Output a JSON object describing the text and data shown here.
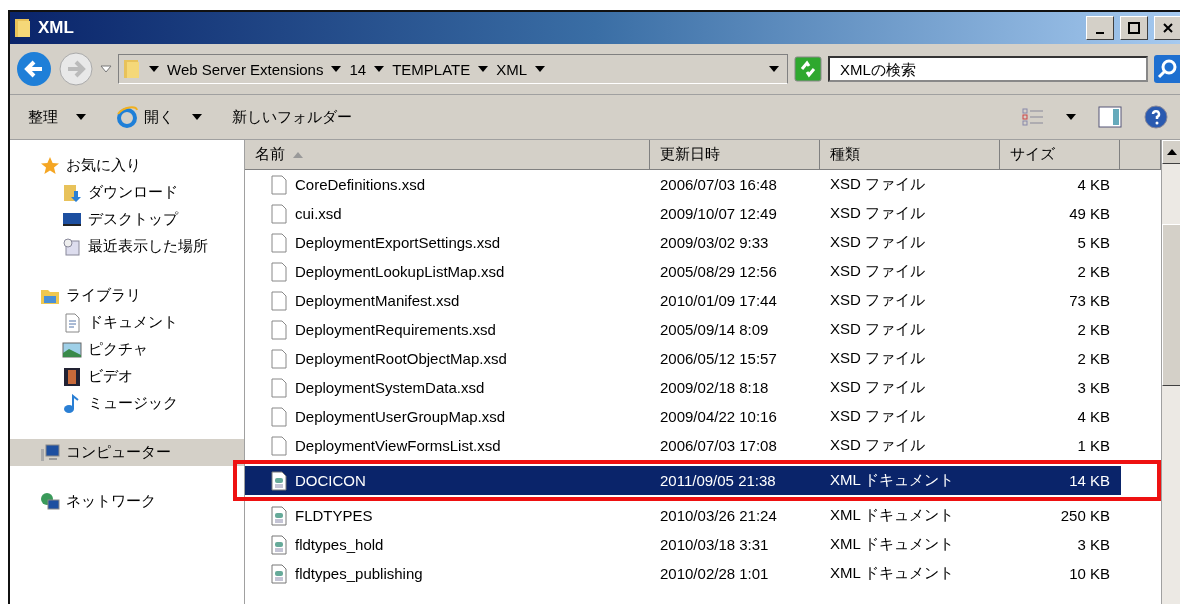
{
  "window": {
    "title": "XML"
  },
  "address": {
    "segments": [
      "Web Server Extensions",
      "14",
      "TEMPLATE",
      "XML"
    ]
  },
  "search": {
    "placeholder": "XMLの検索"
  },
  "toolbar": {
    "items": [
      {
        "label": "整理",
        "dropdown": true
      },
      {
        "label": "開く",
        "dropdown": true
      },
      {
        "label": "新しいフォルダー",
        "dropdown": false
      }
    ]
  },
  "sidebar": {
    "groups": [
      {
        "label": "お気に入り",
        "selected": false,
        "children": [
          {
            "label": "ダウンロード",
            "selected": false
          },
          {
            "label": "デスクトップ",
            "selected": false
          },
          {
            "label": "最近表示した場所",
            "selected": false
          }
        ]
      },
      {
        "label": "ライブラリ",
        "selected": false,
        "children": [
          {
            "label": "ドキュメント",
            "selected": false
          },
          {
            "label": "ピクチャ",
            "selected": false
          },
          {
            "label": "ビデオ",
            "selected": false
          },
          {
            "label": "ミュージック",
            "selected": false
          }
        ]
      },
      {
        "label": "コンピューター",
        "selected": true
      },
      {
        "label": "ネットワーク",
        "selected": false
      }
    ]
  },
  "table": {
    "columns": [
      {
        "label": "名前",
        "sorted": true
      },
      {
        "label": "更新日時",
        "sorted": false
      },
      {
        "label": "種類",
        "sorted": false
      },
      {
        "label": "サイズ",
        "sorted": false
      }
    ],
    "rows": [
      {
        "kind": "xsd",
        "name": "CoreDefinitions.xsd",
        "date": "2006/07/03 16:48",
        "type": "XSD ファイル",
        "size": "4 KB",
        "selected": false,
        "outlined": false
      },
      {
        "kind": "xsd",
        "name": "cui.xsd",
        "date": "2009/10/07 12:49",
        "type": "XSD ファイル",
        "size": "49 KB",
        "selected": false,
        "outlined": false
      },
      {
        "kind": "xsd",
        "name": "DeploymentExportSettings.xsd",
        "date": "2009/03/02 9:33",
        "type": "XSD ファイル",
        "size": "5 KB",
        "selected": false,
        "outlined": false
      },
      {
        "kind": "xsd",
        "name": "DeploymentLookupListMap.xsd",
        "date": "2005/08/29 12:56",
        "type": "XSD ファイル",
        "size": "2 KB",
        "selected": false,
        "outlined": false
      },
      {
        "kind": "xsd",
        "name": "DeploymentManifest.xsd",
        "date": "2010/01/09 17:44",
        "type": "XSD ファイル",
        "size": "73 KB",
        "selected": false,
        "outlined": false
      },
      {
        "kind": "xsd",
        "name": "DeploymentRequirements.xsd",
        "date": "2005/09/14 8:09",
        "type": "XSD ファイル",
        "size": "2 KB",
        "selected": false,
        "outlined": false
      },
      {
        "kind": "xsd",
        "name": "DeploymentRootObjectMap.xsd",
        "date": "2006/05/12 15:57",
        "type": "XSD ファイル",
        "size": "2 KB",
        "selected": false,
        "outlined": false
      },
      {
        "kind": "xsd",
        "name": "DeploymentSystemData.xsd",
        "date": "2009/02/18 8:18",
        "type": "XSD ファイル",
        "size": "3 KB",
        "selected": false,
        "outlined": false
      },
      {
        "kind": "xsd",
        "name": "DeploymentUserGroupMap.xsd",
        "date": "2009/04/22 10:16",
        "type": "XSD ファイル",
        "size": "4 KB",
        "selected": false,
        "outlined": false
      },
      {
        "kind": "xsd",
        "name": "DeploymentViewFormsList.xsd",
        "date": "2006/07/03 17:08",
        "type": "XSD ファイル",
        "size": "1 KB",
        "selected": false,
        "outlined": false
      },
      {
        "kind": "xml",
        "name": "DOCICON",
        "date": "2011/09/05 21:38",
        "type": "XML ドキュメント",
        "size": "14 KB",
        "selected": true,
        "outlined": true
      },
      {
        "kind": "xml",
        "name": "FLDTYPES",
        "date": "2010/03/26 21:24",
        "type": "XML ドキュメント",
        "size": "250 KB",
        "selected": false,
        "outlined": false
      },
      {
        "kind": "xml",
        "name": "fldtypes_hold",
        "date": "2010/03/18 3:31",
        "type": "XML ドキュメント",
        "size": "3 KB",
        "selected": false,
        "outlined": false
      },
      {
        "kind": "xml",
        "name": "fldtypes_publishing",
        "date": "2010/02/28 1:01",
        "type": "XML ドキュメント",
        "size": "10 KB",
        "selected": false,
        "outlined": false
      }
    ]
  }
}
